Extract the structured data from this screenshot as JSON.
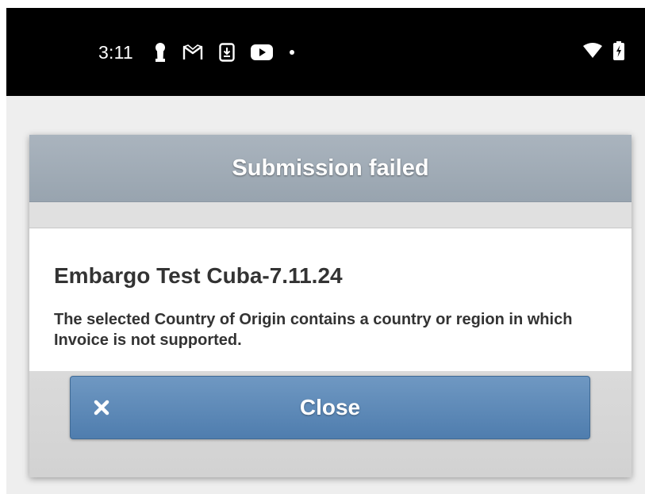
{
  "status_bar": {
    "time": "3:11",
    "notification_icons": [
      "keyhole-icon",
      "gmail-icon",
      "download-icon",
      "youtube-icon",
      "dot-icon"
    ],
    "system_icons": [
      "wifi-icon",
      "battery-charging-icon"
    ]
  },
  "dialog": {
    "title": "Submission failed",
    "message_title": "Embargo Test Cuba-7.11.24",
    "message_text": "The selected Country of Origin contains a country or region in which Invoice is not supported.",
    "close_label": "Close"
  },
  "colors": {
    "header": "#9aa6b1",
    "button": "#5a88b8",
    "status_bar": "#000000"
  }
}
